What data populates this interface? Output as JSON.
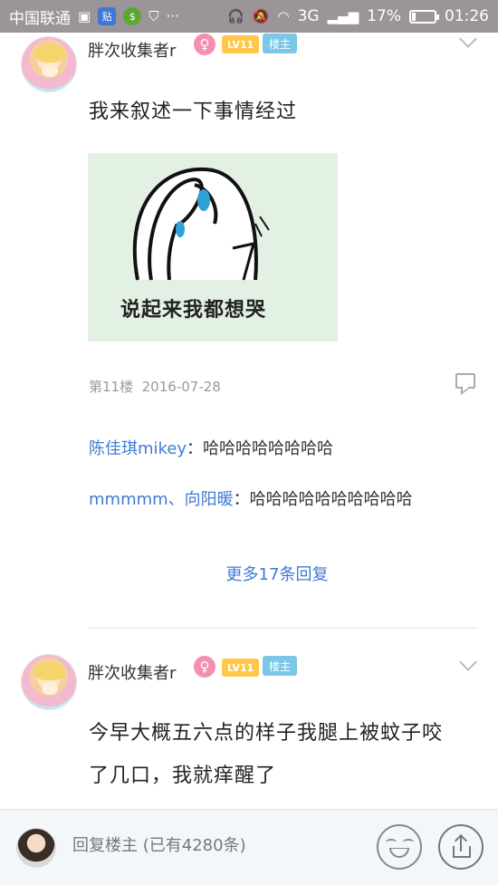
{
  "status_bar": {
    "carrier": "中国联通",
    "battery_percent_label": "17%",
    "battery_level": 0.17,
    "network": "3G",
    "time": "01:26"
  },
  "posts": [
    {
      "username": "胖次收集者r",
      "gender": "♀",
      "level": "LV11",
      "op_badge": "楼主",
      "text": "我来叙述一下事情经过",
      "image_caption": "说起来我都想哭",
      "floor": "第11楼",
      "date": "2016-07-28",
      "replies": [
        {
          "name": "陈佳琪mikey",
          "sep": "：",
          "content": "哈哈哈哈哈哈哈哈"
        },
        {
          "name": "mmmmm、向阳暖",
          "sep": "：",
          "content": "哈哈哈哈哈哈哈哈哈哈"
        }
      ],
      "more_replies": "更多17条回复"
    },
    {
      "username": "胖次收集者r",
      "gender": "♀",
      "level": "LV11",
      "op_badge": "楼主",
      "text_line1": "今早大概五六点的样子我腿上被蚊子咬",
      "text_line2": "了几口，我就痒醒了"
    }
  ],
  "bottom_bar": {
    "reply_label": "回复楼主",
    "reply_count": "(已有4280条)"
  }
}
